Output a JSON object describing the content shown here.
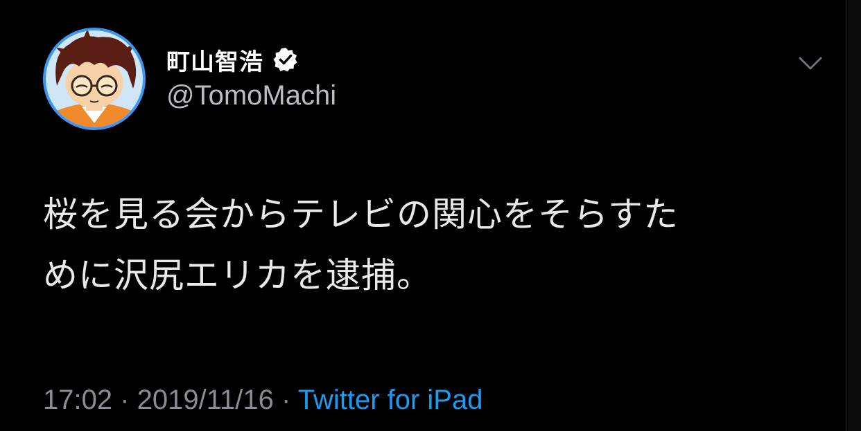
{
  "tweet": {
    "author": {
      "display_name": "町山智浩",
      "handle": "@TomoMachi",
      "verified": true,
      "avatar_icon": "cartoon-avatar"
    },
    "menu_icon": "chevron-down-icon",
    "text_line1": "桜を見る会からテレビの関心をそらすた",
    "text_line2": "めに沢尻エリカを逮捕。",
    "time": "17:02",
    "separator": " · ",
    "date": "2019/11/16",
    "source": "Twitter for iPad"
  },
  "colors": {
    "background": "#000000",
    "text": "#e7e9ea",
    "secondary": "#8a8d91",
    "link": "#1d9bf0",
    "avatar_ring": "#3d97f0"
  }
}
